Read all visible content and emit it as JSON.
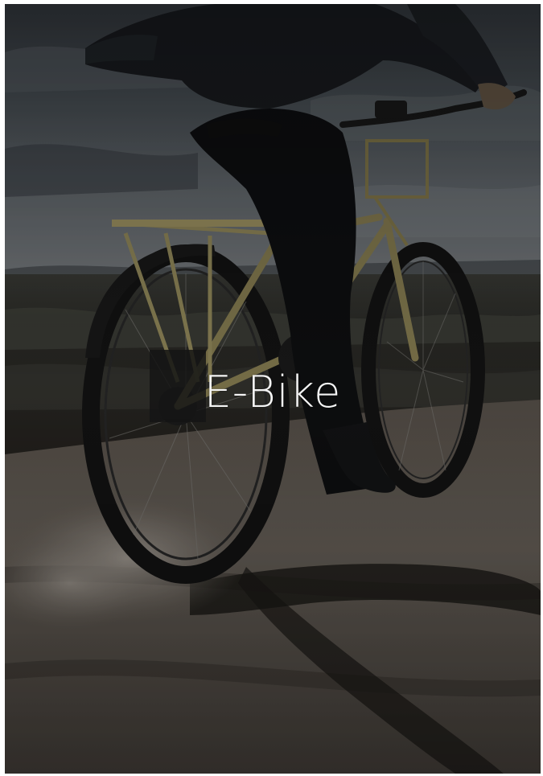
{
  "tile": {
    "title": "E-Bike"
  }
}
